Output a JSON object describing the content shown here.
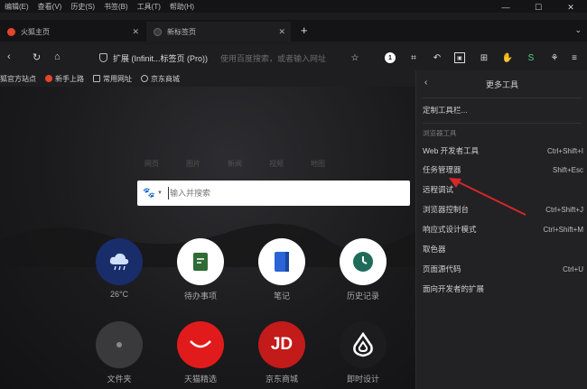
{
  "menubar": [
    "编辑(E)",
    "查看(V)",
    "历史(S)",
    "书签(B)",
    "工具(T)",
    "帮助(H)"
  ],
  "window_controls": [
    "—",
    "☐",
    "✕"
  ],
  "tabs": [
    {
      "label": "火狐主页",
      "active": false,
      "favicon_color": "#e8442a"
    },
    {
      "label": "新标签页",
      "active": true,
      "favicon_color": "#3a3a3e"
    }
  ],
  "newtab_label": "+",
  "address": {
    "url": "扩展 (Infinit...标签页 (Pro))",
    "placeholder": "使用百度搜索，或者输入网址"
  },
  "bookmarks": [
    {
      "label": "火狐官方站点",
      "color": "#e8442a"
    },
    {
      "label": "新手上路",
      "color": "#e8442a"
    },
    {
      "label": "常用网址",
      "color": "#9a9a9a"
    },
    {
      "label": "京东商城",
      "color": "#9a9a9a"
    }
  ],
  "search": {
    "tabs": [
      "网页",
      "图片",
      "新闻",
      "视频",
      "地图"
    ],
    "placeholder": "输入并搜索"
  },
  "tiles": [
    {
      "label": "26°C",
      "bg": "#1a2d6b",
      "icon": "cloud-rain-icon"
    },
    {
      "label": "待办事项",
      "bg": "#ffffff",
      "icon": "notepad-icon"
    },
    {
      "label": "笔记",
      "bg": "#ffffff",
      "icon": "notebook-icon"
    },
    {
      "label": "历史记录",
      "bg": "#ffffff",
      "icon": "clock-icon"
    },
    {
      "label": "文件夹",
      "bg": "#3a3a3c",
      "icon": "folder-icon"
    },
    {
      "label": "天猫精选",
      "bg": "#e11b1b",
      "icon": "tmall-icon"
    },
    {
      "label": "京东商城",
      "bg": "#c31a1a",
      "icon": "jd-icon"
    },
    {
      "label": "即时设计",
      "bg": "#1c1c1e",
      "icon": "drop-logo-icon"
    }
  ],
  "jd_text": "JD",
  "panel": {
    "title": "更多工具",
    "customize": "定制工具栏...",
    "section": "浏览器工具",
    "items": [
      {
        "label": "Web 开发者工具",
        "shortcut": "Ctrl+Shift+I"
      },
      {
        "label": "任务管理器",
        "shortcut": "Shift+Esc"
      },
      {
        "label": "远程调试",
        "shortcut": ""
      },
      {
        "label": "浏览器控制台",
        "shortcut": "Ctrl+Shift+J"
      },
      {
        "label": "响应式设计模式",
        "shortcut": "Ctrl+Shift+M"
      },
      {
        "label": "取色器",
        "shortcut": ""
      },
      {
        "label": "页面源代码",
        "shortcut": "Ctrl+U"
      },
      {
        "label": "面向开发者的扩展",
        "shortcut": ""
      }
    ]
  },
  "colors": {
    "accent_arrow": "#d62828",
    "panel_bg": "#222225"
  }
}
